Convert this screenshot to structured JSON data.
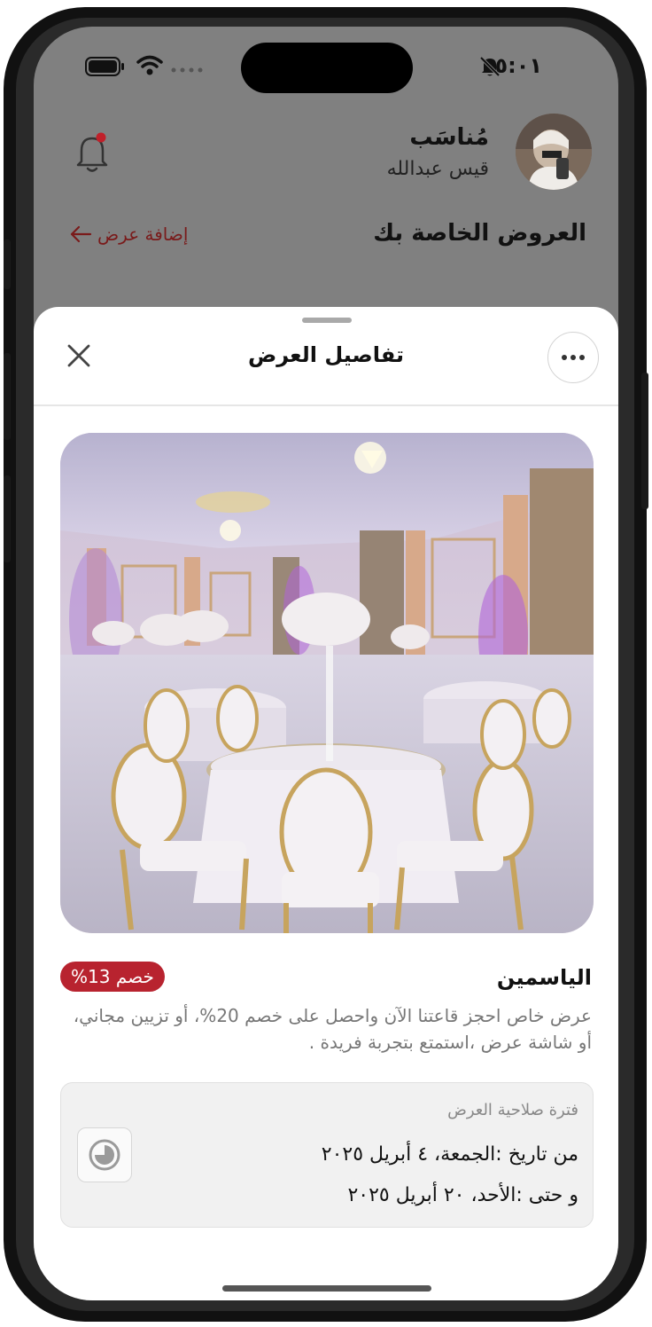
{
  "status_bar": {
    "time": "٥:٠١"
  },
  "header": {
    "name": "مُناسَب",
    "subtitle": "قيس عبدالله",
    "section_title": "العروض الخاصة بك",
    "add_offer": "إضافة عرض"
  },
  "sheet": {
    "title": "تفاصيل العرض",
    "offer": {
      "name": "الياسمين",
      "discount": "خصم 13%",
      "description": "عرض خاص احجز قاعتنا الآن واحصل على خصم 20%، أو تزيين مجاني، أو شاشة عرض ،استمتع بتجربة فريدة ."
    },
    "validity": {
      "label": "فترة صلاحية العرض",
      "from": "من تاريخ :الجمعة، ٤ أبريل ٢٠٢٥",
      "to": "و حتى :الأحد، ٢٠ أبريل ٢٠٢٥"
    }
  },
  "colors": {
    "accent": "#b8232f",
    "link": "#7a1b1b",
    "notification_dot": "#c0202a"
  },
  "icons": [
    "bell-slash-icon",
    "wifi-icon",
    "battery-icon",
    "bell-icon",
    "arrow-left-icon",
    "more-icon",
    "close-icon",
    "clock-icon"
  ]
}
